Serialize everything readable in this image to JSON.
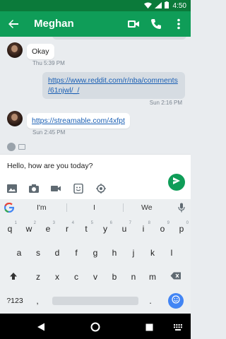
{
  "status_bar": {
    "time": "4:50"
  },
  "header": {
    "contact_name": "Meghan"
  },
  "thread": {
    "messages": [
      {
        "direction": "in",
        "text": "Okay",
        "timestamp": "Thu 5:39 PM"
      },
      {
        "direction": "out",
        "text": "https://www.reddit.com/r/nba/comments/61njwl/_/",
        "timestamp": "Sun 2:16 PM"
      },
      {
        "direction": "in",
        "text": "https://streamable.com/4xfpt",
        "timestamp": "Sun 2:45 PM"
      }
    ],
    "out_line1": "https://www.reddit.com/r/nba/comments",
    "out_line2": "/61njwl/_/"
  },
  "compose": {
    "value": "Hello, how are you today?"
  },
  "keyboard": {
    "suggestions": [
      "I'm",
      "I",
      "We"
    ],
    "row1": [
      "q",
      "w",
      "e",
      "r",
      "t",
      "y",
      "u",
      "i",
      "o",
      "p"
    ],
    "row1_hints": [
      "1",
      "2",
      "3",
      "4",
      "5",
      "6",
      "7",
      "8",
      "9",
      "0"
    ],
    "row2": [
      "a",
      "s",
      "d",
      "f",
      "g",
      "h",
      "j",
      "k",
      "l"
    ],
    "row3": [
      "z",
      "x",
      "c",
      "v",
      "b",
      "n",
      "m"
    ],
    "symbols_key": "?123",
    "comma_key": ",",
    "period_key": "."
  },
  "colors": {
    "app_bar": "#0f9d58",
    "status_bar": "#0b7a3a",
    "link": "#1a5fb4",
    "emoji_key": "#4285f4"
  }
}
